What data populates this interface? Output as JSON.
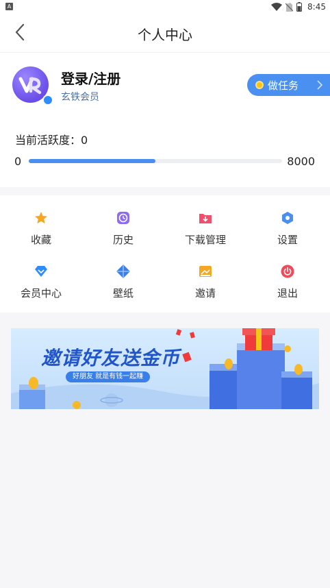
{
  "status": {
    "time": "8:45",
    "left_badge": "A"
  },
  "header": {
    "title": "个人中心"
  },
  "profile": {
    "name": "登录/注册",
    "membership": "玄铁会员",
    "task_button": "做任务",
    "activity_label": "当前活跃度：0",
    "progress_min": "0",
    "progress_max": "8000",
    "progress_fraction": 0.5
  },
  "menu": {
    "items": [
      {
        "label": "收藏",
        "icon": "star-icon",
        "color": "#f5a623"
      },
      {
        "label": "历史",
        "icon": "clock-icon",
        "color": "#8e6cf0"
      },
      {
        "label": "下载管理",
        "icon": "download-icon",
        "color": "#f0506e"
      },
      {
        "label": "设置",
        "icon": "gear-icon",
        "color": "#4a8ff0"
      },
      {
        "label": "会员中心",
        "icon": "diamond-icon",
        "color": "#2f8cff"
      },
      {
        "label": "壁纸",
        "icon": "wallpaper-icon",
        "color": "#3a7ee8"
      },
      {
        "label": "邀请",
        "icon": "invite-icon",
        "color": "#f5a623"
      },
      {
        "label": "退出",
        "icon": "power-icon",
        "color": "#f04a5a"
      }
    ]
  },
  "banner": {
    "title": "邀请好友送金币",
    "subtitle": "好朋友 就是有钱一起赚"
  },
  "colors": {
    "accent": "#4a90f0",
    "background": "#f6f6f8"
  }
}
